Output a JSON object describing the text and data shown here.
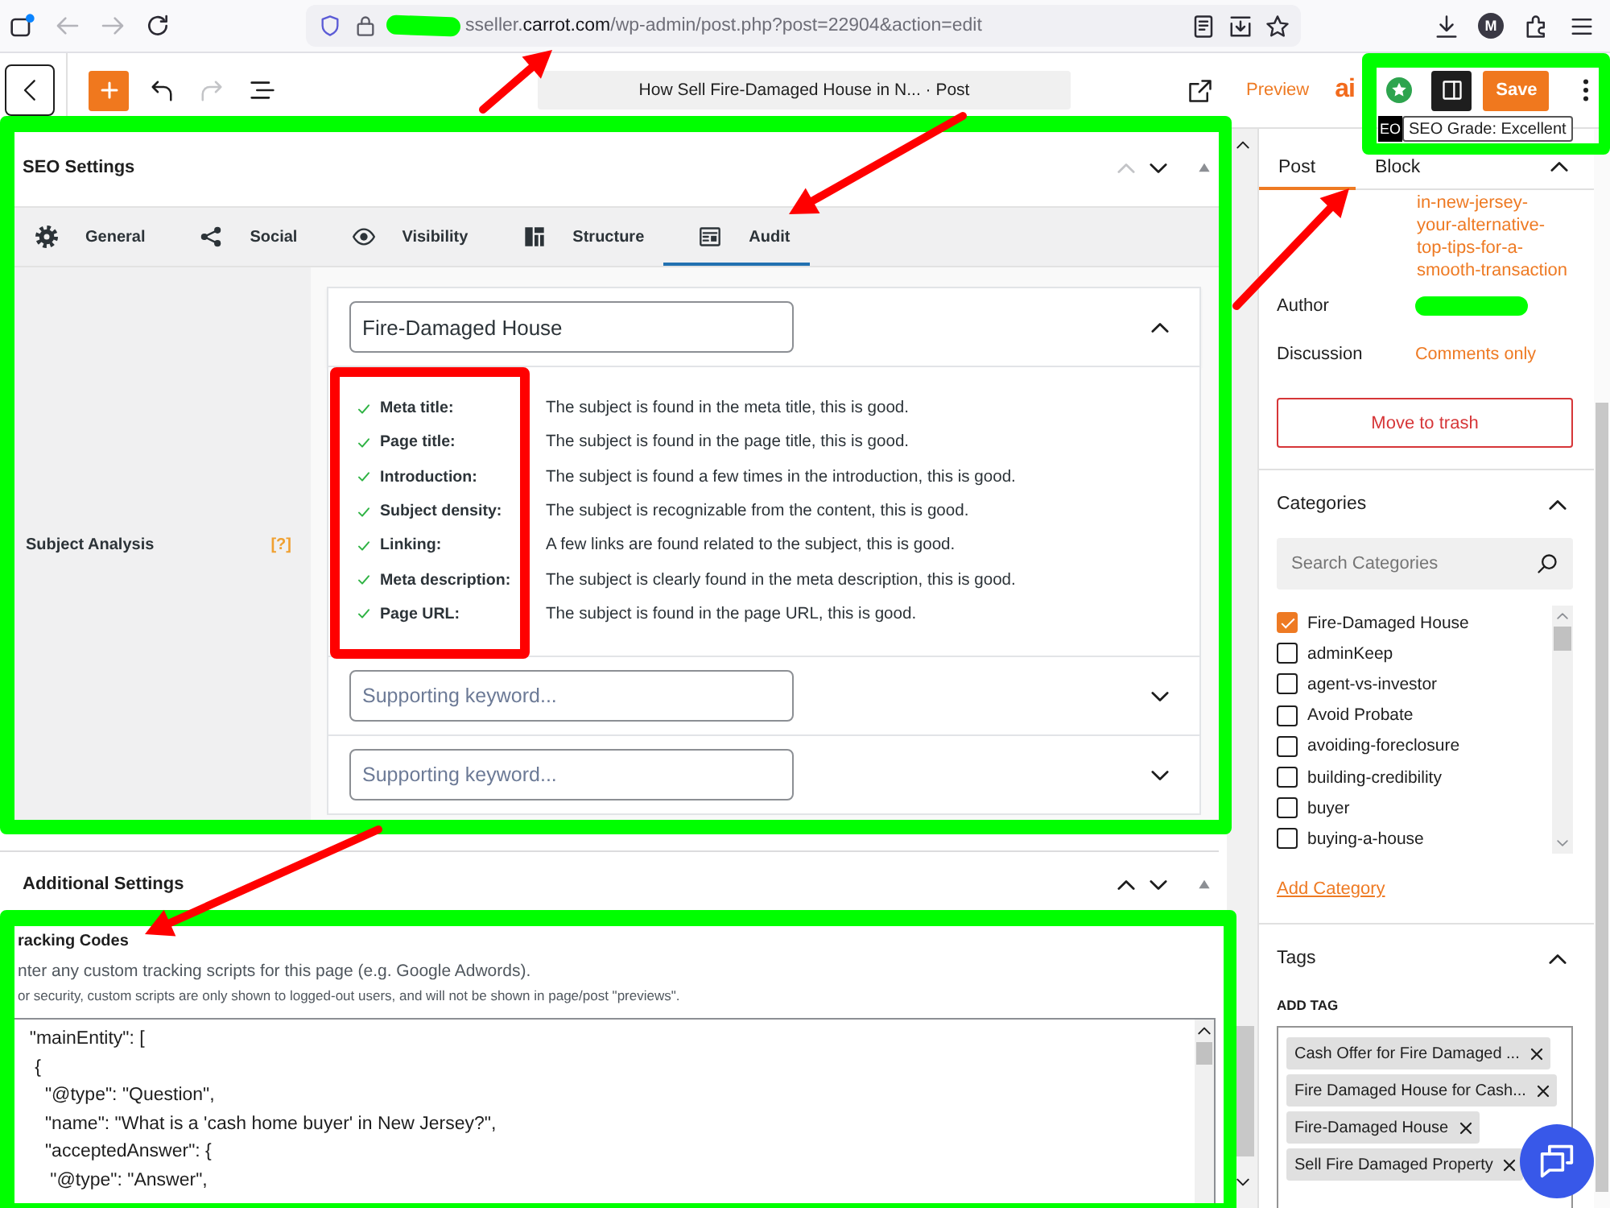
{
  "browser": {
    "back_disabled": true,
    "forward_disabled": true,
    "url_redacted": true,
    "url_subdomain": "sseller.",
    "url_domain": "carrot.com",
    "url_path": "/wp-admin/post.php?post=22904&action=edit",
    "profile_initial": "M"
  },
  "editor_toolbar": {
    "undo_disabled": false,
    "redo_disabled": true,
    "post_title": "How Sell Fire-Damaged House in N... · Post",
    "preview": "Preview",
    "logo": "ai",
    "sidebar_open": true,
    "save": "Save"
  },
  "seo_badge": {
    "fragment": "EO",
    "tooltip": "SEO Grade: Excellent"
  },
  "seo_settings": {
    "title": "SEO Settings",
    "move_up_disabled": true,
    "expanded": true,
    "tabs": [
      {
        "label": "General",
        "kind": "gear",
        "selected": false
      },
      {
        "label": "Social",
        "kind": "share",
        "selected": false
      },
      {
        "label": "Visibility",
        "kind": "eye",
        "selected": false
      },
      {
        "label": "Structure",
        "kind": "structure",
        "selected": false
      },
      {
        "label": "Audit",
        "kind": "document",
        "selected": true
      }
    ],
    "side_label": "Subject Analysis",
    "help_mark": "[?]",
    "focus_keyword": {
      "value": "Fire-Damaged House",
      "expanded": true,
      "checks": [
        {
          "label": "Meta title:",
          "message": "The subject is found in the meta title, this is good.",
          "passed": true
        },
        {
          "label": "Page title:",
          "message": "The subject is found in the page title, this is good.",
          "passed": true
        },
        {
          "label": "Introduction:",
          "message": "The subject is found a few times in the introduction, this is good.",
          "passed": true
        },
        {
          "label": "Subject density:",
          "message": "The subject is recognizable from the content, this is good.",
          "passed": true
        },
        {
          "label": "Linking:",
          "message": "A few links are found related to the subject, this is good.",
          "passed": true
        },
        {
          "label": "Meta description:",
          "message": "The subject is clearly found in the meta description, this is good.",
          "passed": true
        },
        {
          "label": "Page URL:",
          "message": "The subject is found in the page URL, this is good.",
          "passed": true
        }
      ]
    },
    "supporting_keywords": [
      {
        "placeholder": "Supporting keyword...",
        "expanded": false
      },
      {
        "placeholder": "Supporting keyword...",
        "expanded": false
      }
    ]
  },
  "additional_settings": {
    "title": "Additional Settings",
    "move_up_disabled": false,
    "expanded": true,
    "tracking": {
      "title": "racking Codes",
      "description": "nter any custom tracking scripts for this page (e.g. Google Adwords).",
      "note": "or security, custom scripts are only shown to logged-out users, and will not be shown in page/post \"previews\".",
      "code_lines": [
        "  \"mainEntity\": [",
        "   {",
        "     \"@type\": \"Question\",",
        "     \"name\": \"What is a 'cash home buyer' in New Jersey?\",",
        "     \"acceptedAnswer\": {",
        "      \"@type\": \"Answer\","
      ]
    }
  },
  "sidebar": {
    "tabs": [
      {
        "label": "Post",
        "selected": true
      },
      {
        "label": "Block",
        "selected": false
      }
    ],
    "slug_lines": [
      "in-new-jersey-",
      "your-alternative-",
      "top-tips-for-a-",
      "smooth-transaction"
    ],
    "author": {
      "label": "Author",
      "redacted": true
    },
    "discussion": {
      "label": "Discussion",
      "value": "Comments only"
    },
    "trash": "Move to trash",
    "categories": {
      "title": "Categories",
      "expanded": true,
      "search_placeholder": "Search Categories",
      "items": [
        {
          "label": "Fire-Damaged House",
          "checked": true
        },
        {
          "label": "adminKeep",
          "checked": false
        },
        {
          "label": "agent-vs-investor",
          "checked": false
        },
        {
          "label": "Avoid Probate",
          "checked": false
        },
        {
          "label": "avoiding-foreclosure",
          "checked": false
        },
        {
          "label": "building-credibility",
          "checked": false
        },
        {
          "label": "buyer",
          "checked": false
        },
        {
          "label": "buying-a-house",
          "checked": false
        }
      ],
      "add_link": "Add Category"
    },
    "tags": {
      "title": "Tags",
      "expanded": true,
      "add_label": "ADD TAG",
      "items": [
        "Cash Offer for Fire Damaged ...",
        "Fire Damaged House for Cash...",
        "Fire-Damaged House",
        "Sell Fire Damaged Property"
      ]
    }
  },
  "annotations": [
    {
      "kind": "frame",
      "color": "#00ff00"
    },
    {
      "kind": "frame",
      "color": "#00ff00"
    },
    {
      "kind": "frame",
      "color": "#00ff00"
    },
    {
      "kind": "frame",
      "color": "#ff0000"
    },
    {
      "kind": "arrow",
      "color": "#ff0000"
    },
    {
      "kind": "arrow",
      "color": "#ff0000"
    },
    {
      "kind": "arrow",
      "color": "#ff0000"
    },
    {
      "kind": "arrow",
      "color": "#ff0000"
    }
  ]
}
